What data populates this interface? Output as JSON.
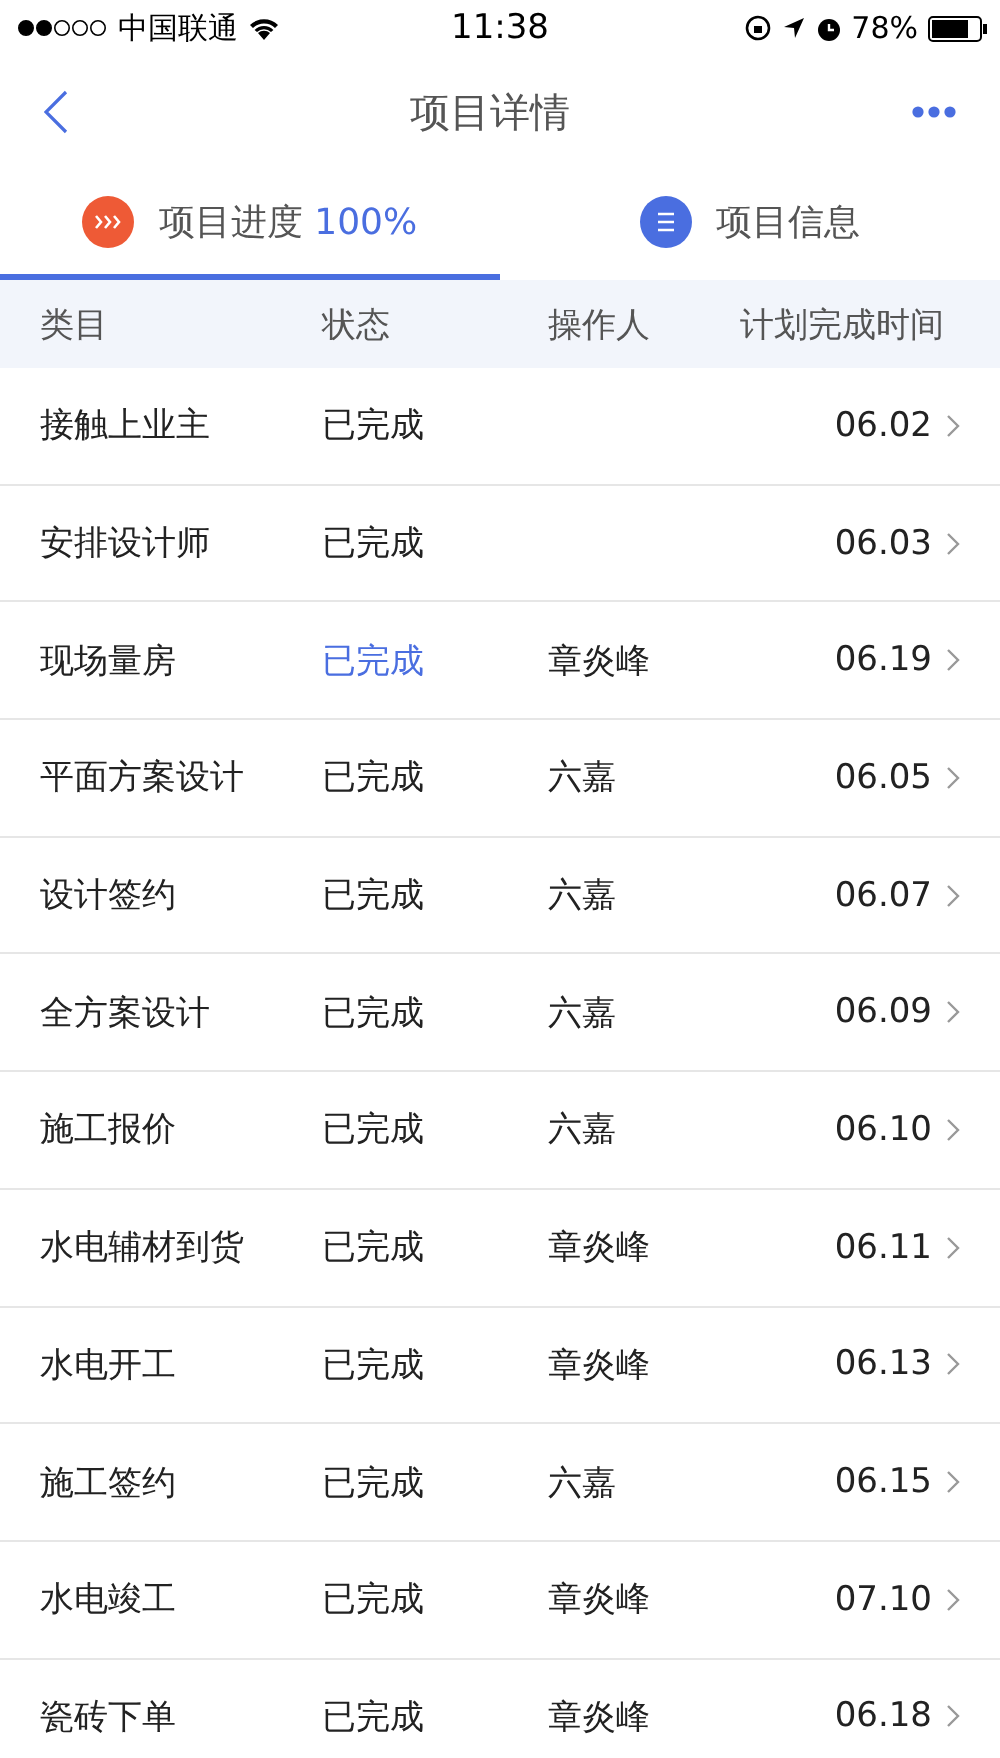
{
  "status_bar": {
    "carrier": "中国联通",
    "time": "11:38",
    "battery": "78%"
  },
  "nav": {
    "title": "项目详情"
  },
  "tabs": [
    {
      "label": "项目进度",
      "value": "100%",
      "kind": "progress",
      "selected": true
    },
    {
      "label": "项目信息",
      "kind": "info",
      "selected": false
    }
  ],
  "table": {
    "columns": [
      "类目",
      "状态",
      "操作人",
      "计划完成时间"
    ],
    "rows": [
      {
        "category": "接触上业主",
        "status": "已完成",
        "status_highlighted": false,
        "operator": "",
        "date": "06.02"
      },
      {
        "category": "安排设计师",
        "status": "已完成",
        "status_highlighted": false,
        "operator": "",
        "date": "06.03"
      },
      {
        "category": "现场量房",
        "status": "已完成",
        "status_highlighted": true,
        "operator": "章炎峰",
        "date": "06.19"
      },
      {
        "category": "平面方案设计",
        "status": "已完成",
        "status_highlighted": false,
        "operator": "六嘉",
        "date": "06.05"
      },
      {
        "category": "设计签约",
        "status": "已完成",
        "status_highlighted": false,
        "operator": "六嘉",
        "date": "06.07"
      },
      {
        "category": "全方案设计",
        "status": "已完成",
        "status_highlighted": false,
        "operator": "六嘉",
        "date": "06.09"
      },
      {
        "category": "施工报价",
        "status": "已完成",
        "status_highlighted": false,
        "operator": "六嘉",
        "date": "06.10"
      },
      {
        "category": "水电辅材到货",
        "status": "已完成",
        "status_highlighted": false,
        "operator": "章炎峰",
        "date": "06.11"
      },
      {
        "category": "水电开工",
        "status": "已完成",
        "status_highlighted": false,
        "operator": "章炎峰",
        "date": "06.13"
      },
      {
        "category": "施工签约",
        "status": "已完成",
        "status_highlighted": false,
        "operator": "六嘉",
        "date": "06.15"
      },
      {
        "category": "水电竣工",
        "status": "已完成",
        "status_highlighted": false,
        "operator": "章炎峰",
        "date": "07.10"
      },
      {
        "category": "瓷砖下单",
        "status": "已完成",
        "status_highlighted": false,
        "operator": "章炎峰",
        "date": "06.18"
      }
    ]
  }
}
